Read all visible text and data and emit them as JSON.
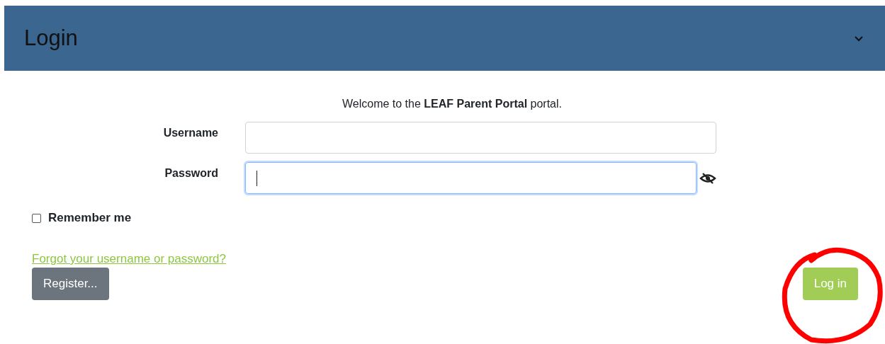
{
  "header": {
    "title": "Login",
    "expanded": true
  },
  "welcome": "Welcome to the **LEAF Parent Portal** portal.",
  "fields": [
    {
      "label": "Username",
      "kind": "text",
      "focused": false
    },
    {
      "label": "Password",
      "kind": "password",
      "focused": true
    }
  ],
  "remember_me": {
    "label": "Remember me",
    "checked": false
  },
  "forgot_link": "Forgot your username or password?",
  "buttons": [
    {
      "label": "Register...",
      "kind": "secondary"
    },
    {
      "label": "Log in",
      "kind": "primary"
    }
  ]
}
